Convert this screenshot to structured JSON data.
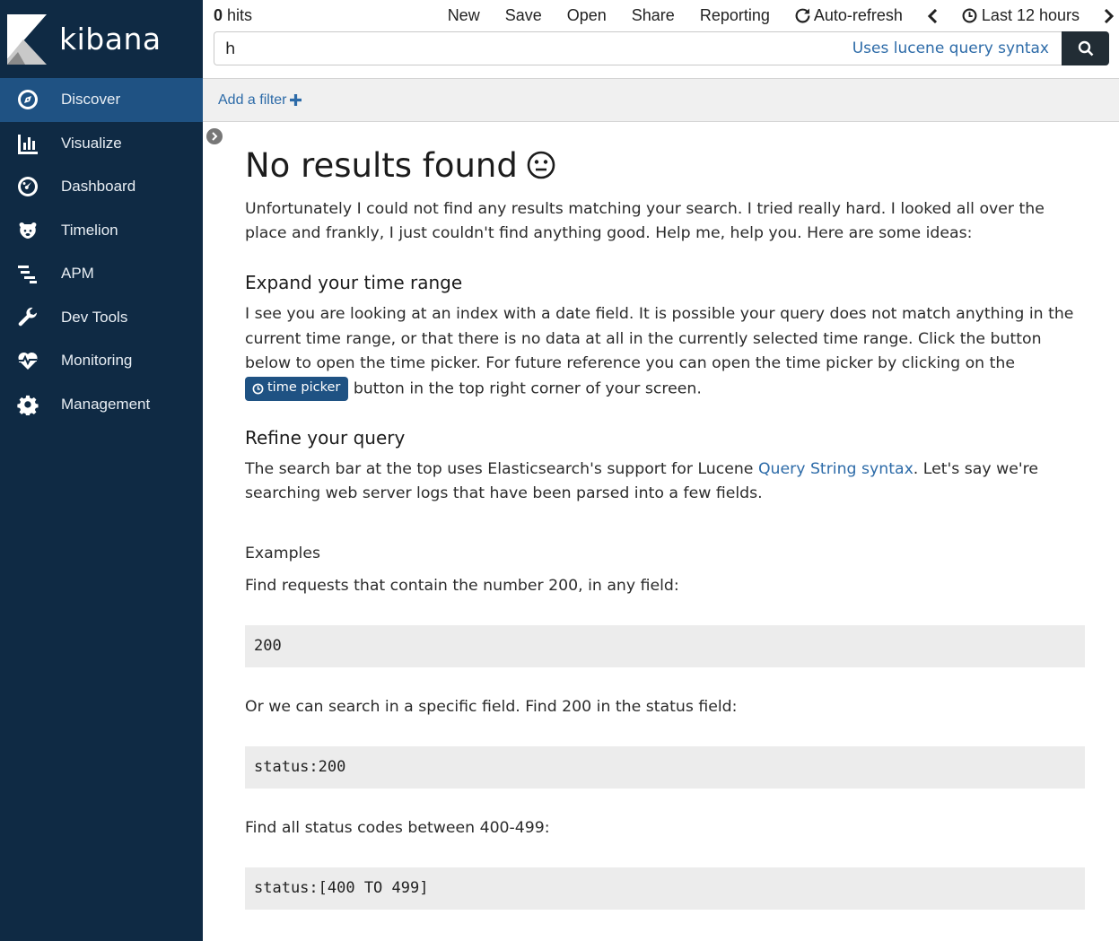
{
  "sidebar": {
    "brand": "kibana",
    "items": [
      {
        "label": "Discover",
        "icon": "compass-icon",
        "active": true
      },
      {
        "label": "Visualize",
        "icon": "bar-chart-icon"
      },
      {
        "label": "Dashboard",
        "icon": "dashboard-icon"
      },
      {
        "label": "Timelion",
        "icon": "bear-icon"
      },
      {
        "label": "APM",
        "icon": "apm-icon"
      },
      {
        "label": "Dev Tools",
        "icon": "wrench-icon"
      },
      {
        "label": "Monitoring",
        "icon": "heartbeat-icon"
      },
      {
        "label": "Management",
        "icon": "gear-icon"
      }
    ]
  },
  "topbar": {
    "hits_count": "0",
    "hits_label": " hits",
    "menu": {
      "new": "New",
      "save": "Save",
      "open": "Open",
      "share": "Share",
      "reporting": "Reporting",
      "auto_refresh": "Auto-refresh",
      "time_range": "Last 12 hours"
    },
    "query_value": "h",
    "query_hint": "Uses lucene query syntax"
  },
  "filterbar": {
    "add_filter": "Add a filter"
  },
  "content": {
    "title": "No results found",
    "intro": "Unfortunately I could not find any results matching your search. I tried really hard. I looked all over the place and frankly, I just couldn't find anything good. Help me, help you. Here are some ideas:",
    "expand_heading": "Expand your time range",
    "expand_text_1": "I see you are looking at an index with a date field. It is possible your query does not match anything in the current time range, or that there is no data at all in the currently selected time range. Click the button below to open the time picker. For future reference you can open the time picker by clicking on the ",
    "time_picker_label": "time picker",
    "expand_text_2": " button in the top right corner of your screen.",
    "refine_heading": "Refine your query",
    "refine_text_1": "The search bar at the top uses Elasticsearch's support for Lucene ",
    "refine_link": "Query String syntax",
    "refine_text_2": ". Let's say we're searching web server logs that have been parsed into a few fields.",
    "examples_heading": "Examples",
    "example1_desc": "Find requests that contain the number 200, in any field:",
    "example1_code": "200",
    "example2_desc": "Or we can search in a specific field. Find 200 in the status field:",
    "example2_code": "status:200",
    "example3_desc": "Find all status codes between 400-499:",
    "example3_code": "status:[400 TO 499]"
  }
}
